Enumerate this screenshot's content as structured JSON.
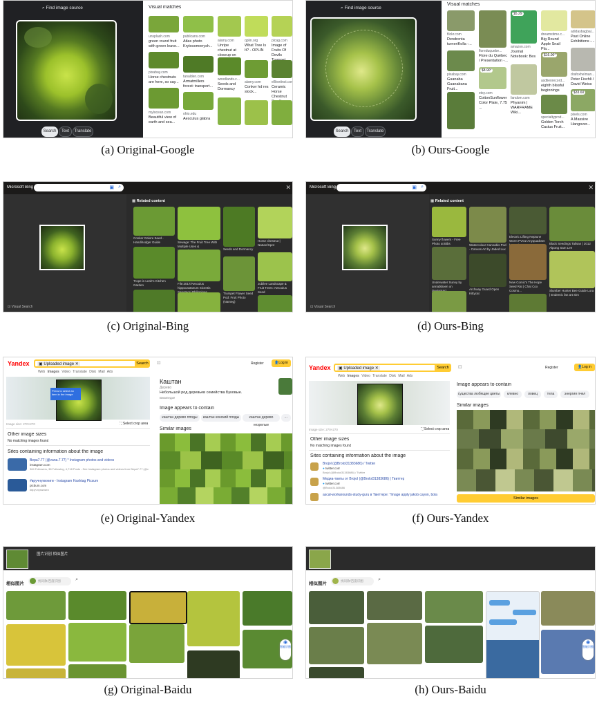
{
  "captions": {
    "a": "(a) Original-Google",
    "b": "(b) Ours-Google",
    "c": "(c) Original-Bing",
    "d": "(d) Ours-Bing",
    "e": "(e) Original-Yandex",
    "f": "(f) Ours-Yandex",
    "g": "(g) Original-Baidu",
    "h": "(h) Ours-Baidu"
  },
  "google": {
    "find_source": "Find image source",
    "visual_matches": "Visual matches",
    "btn_search": "Search",
    "btn_text": "Text",
    "btn_translate": "Translate",
    "orig_results": [
      {
        "src": "unsplash.com",
        "title": "green round fruit with green leave..."
      },
      {
        "src": "pixabay.com",
        "title": "Horse chestnuts are here, so say..."
      },
      {
        "src": "mylocean.com",
        "title": "Beautiful view of earth and sea..."
      },
      {
        "src": "publicans.com",
        "title": "Atlas photo Krytosomenysh..."
      },
      {
        "src": "tanalden.com",
        "title": "Armatmillers forest: transport..."
      },
      {
        "src": "ohio.edu",
        "title": "Aesculus glabra"
      },
      {
        "src": "alamy.com",
        "title": "Unripe chestnut at closeup on tre..."
      },
      {
        "src": "woodlands.c...",
        "title": "Seeds and Dormancy"
      },
      {
        "src": "qplin.org",
        "title": "What Tree Is It? - OPLIN"
      },
      {
        "src": "alamy.com",
        "title": "Conker hd res stock..."
      },
      {
        "src": "plcag.com",
        "title": "Image of Fruits Of Devils Trumpet..."
      },
      {
        "src": "eBiextinct.com",
        "title": "Ceramic Horse Chestnut Small"
      }
    ],
    "ours_results": [
      {
        "src": "flickr.com",
        "title": "Dendrenta turneriKolla -..."
      },
      {
        "src": "floreduquebe...",
        "title": "Flore du Québec / Presentation -..."
      },
      {
        "src": "pixabay.com",
        "title": "Guanaba Guanabana Fruit..."
      },
      {
        "src": "amazon.com",
        "title": "Journal Notebook: Bes"
      },
      {
        "src": "etsy.com",
        "title": "CottonSunflower Color Plate, 7.75 ..."
      },
      {
        "src": "fandom.com",
        "title": "Phyanim | WARFRAME Wiki..."
      },
      {
        "src": "dreamstime.c...",
        "title": "Big Round Apple Snail Pla..."
      },
      {
        "src": "asdlienrecord...",
        "title": "eighth blissful beginnings"
      },
      {
        "src": "specialtyprod...",
        "title": "Golden Torch Cactus Fruit..."
      },
      {
        "src": "adidasbagbal...",
        "title": "Past Online Exhibitions -..."
      },
      {
        "src": "drafoxhelman...",
        "title": "Peter Fischli / David Weiss"
      },
      {
        "src": "pixels.com",
        "title": "A Massive Hangover..."
      }
    ],
    "prices": [
      "$5.29",
      "$8.90*",
      "$16.00*",
      "$33.60"
    ]
  },
  "bing": {
    "logo": "Microsoft Bing",
    "related": "Related content",
    "visual_search": "Visual Search",
    "orig_captions": [
      "Conker Galore Seed - Handihodger Guide",
      "Sewage: The Fruit Tree With Multiple Uses & Interestinung...",
      "Seeds and Dormancy",
      "Horse chestnut | Nature/Spot",
      "Trope is Leah's Kitchen Garden",
      "File:2017/Aesculus hippocastanum Sicentis Sapotacsi Philippines",
      "Trumpet Flower Seed Pod: Fruit Photo (Nameg)",
      "Jubilee Landscape & Fruit Trees: Aesculus Seed"
    ],
    "ours_captions": [
      "Sunny flowers - Free Photo at Bibs",
      "Watercolour Cannabis Pod - Canvas Art by Jaded Lux",
      "Electric Lifting Neptune Worm PVG2 Anyquadram by Woia",
      "Black Seedings Talisan | 2012 Alpong Sam Lee",
      "Underwater Sunny by annabbioen on DeviantArt",
      "Archway Guard Open Kittycat",
      "New Comic's The Hope Seed Rat | Chat Cox Cosmo...",
      "Slumber Hunter Bee Guide Lora | Endemic fan art Sim"
    ]
  },
  "yandex": {
    "logo": "Yandex",
    "chip": "Uploaded image",
    "search_btn": "Search",
    "register": "Register",
    "login": "Log in",
    "tabs": [
      "Web",
      "Images",
      "Video",
      "Translate",
      "Disk",
      "Mail",
      "Ads"
    ],
    "tooltip": "Press to select an item in the image",
    "image_size": "Image size: 270×270",
    "select_crop": "Select crop area",
    "other_sizes": "Other image sizes",
    "no_match": "No matching images found",
    "sites_heading": "Sites containing information about the image",
    "orig_title": "Каштан",
    "orig_subtitle": "Дерево",
    "orig_desc": "Небольшой род деревьев семейства Буковые.",
    "orig_wiki": "Википедия",
    "appears": "Image appears to contain",
    "orig_chips": [
      "каштан дерево плоды",
      "каштан конский плоды",
      "каштан дерево незрелые"
    ],
    "similar": "Similar images",
    "orig_sites": [
      {
        "title": "Bepa7.77 (@vana.7.77) * Instagram photos and videos",
        "host": "instagram.com",
        "desc": "384 Followers, 38 Following, 4,718 Posts - See Instagram photos and videos from Bepa7.77 (@vana.7.77)"
      },
      {
        "title": "#вручнуюкниги - Instagram Hashtag Picsum",
        "host": "picbum.com",
        "desc": "#вручнуюкниги"
      }
    ],
    "ours_chips": [
      "существа любящие цветы",
      "клевно",
      "ловец",
      "тела",
      "энергия пчел"
    ],
    "ours_sites": [
      {
        "title": "Brojol (@Brolol31383686) / Twitter",
        "host": "twitter.com",
        "desc": "Brojol (@Brolol31383686) / Twitter"
      },
      {
        "title": "Медиа-твиты от Brojol (@Brolol31383686) | Твиттер",
        "host": "twitter.com",
        "desc": "@Brolol31383686"
      },
      {
        "title": "ascal-workarounds-study-guru в Твиттере: \"Image apply jakob cayon, bola",
        "host": "",
        "desc": ""
      }
    ],
    "similar_btn": "Similar images"
  },
  "baidu": {
    "top_links": "图片识别  相似图片",
    "similar": "相似图片",
    "search_placeholder": "找同款/百度识图",
    "side_btn": "智能识图"
  }
}
